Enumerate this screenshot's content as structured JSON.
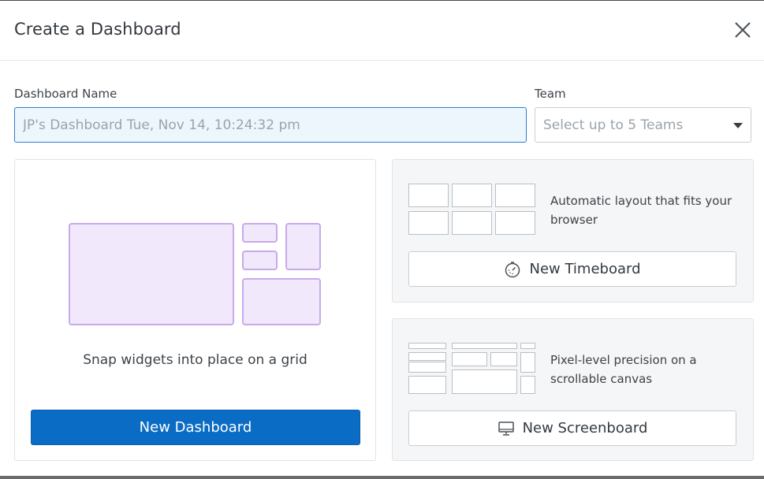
{
  "modal": {
    "title": "Create a Dashboard",
    "close_icon": "close-icon"
  },
  "form": {
    "name_label": "Dashboard Name",
    "name_placeholder": "JP's Dashboard Tue, Nov 14, 10:24:32 pm",
    "name_value": "",
    "team_label": "Team",
    "team_placeholder": "Select up to 5 Teams"
  },
  "options": {
    "dashboard": {
      "caption": "Snap widgets into place on a grid",
      "button_label": "New Dashboard",
      "accent_color": "#0a6cc4",
      "illustration_color": "#f1e9fb"
    },
    "timeboard": {
      "description": "Automatic layout that fits your browser",
      "button_label": "New Timeboard",
      "icon": "stopwatch-icon"
    },
    "screenboard": {
      "description": "Pixel-level precision on a scrollable canvas",
      "button_label": "New Screenboard",
      "icon": "monitor-icon"
    }
  }
}
